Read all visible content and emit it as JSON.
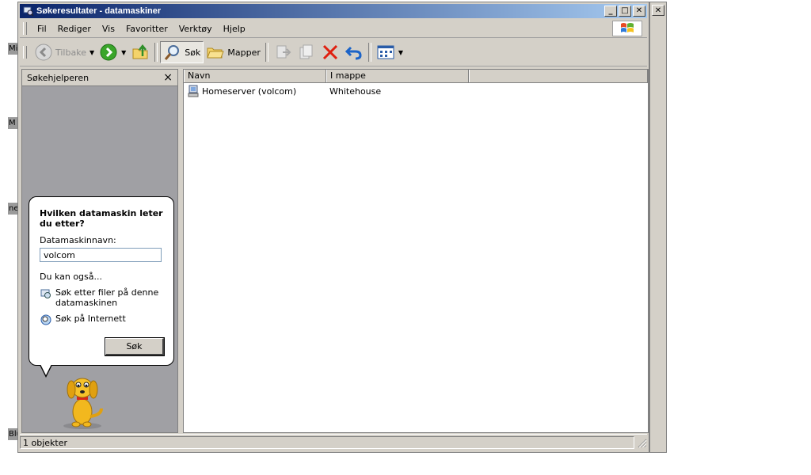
{
  "desktop": {
    "labels": [
      "Mir",
      "M",
      "ne",
      "Blu"
    ]
  },
  "window": {
    "title": "Søkeresultater - datamaskiner",
    "buttons": {
      "minimize": "_",
      "maximize": "□",
      "close": "✕"
    }
  },
  "menu": {
    "items": [
      "Fil",
      "Rediger",
      "Vis",
      "Favoritter",
      "Verktøy",
      "Hjelp"
    ]
  },
  "toolbar": {
    "back_label": "Tilbake",
    "search_label": "Søk",
    "folders_label": "Mapper"
  },
  "search_pane": {
    "header": "Søkehjelperen",
    "question": "Hvilken datamaskin leter du etter?",
    "name_label": "Datamaskinnavn:",
    "name_value": "volcom",
    "also_label": "Du kan også...",
    "links": [
      "Søk etter filer på denne datamaskinen",
      "Søk på Internett"
    ],
    "search_button": "Søk"
  },
  "results": {
    "columns": [
      "Navn",
      "I mappe"
    ],
    "rows": [
      {
        "name": "Homeserver (volcom)",
        "folder": "Whitehouse"
      }
    ]
  },
  "status": {
    "text": "1 objekter"
  },
  "colors": {
    "title_start": "#0a246a",
    "title_end": "#a6caf0",
    "face": "#d4d0c8"
  }
}
